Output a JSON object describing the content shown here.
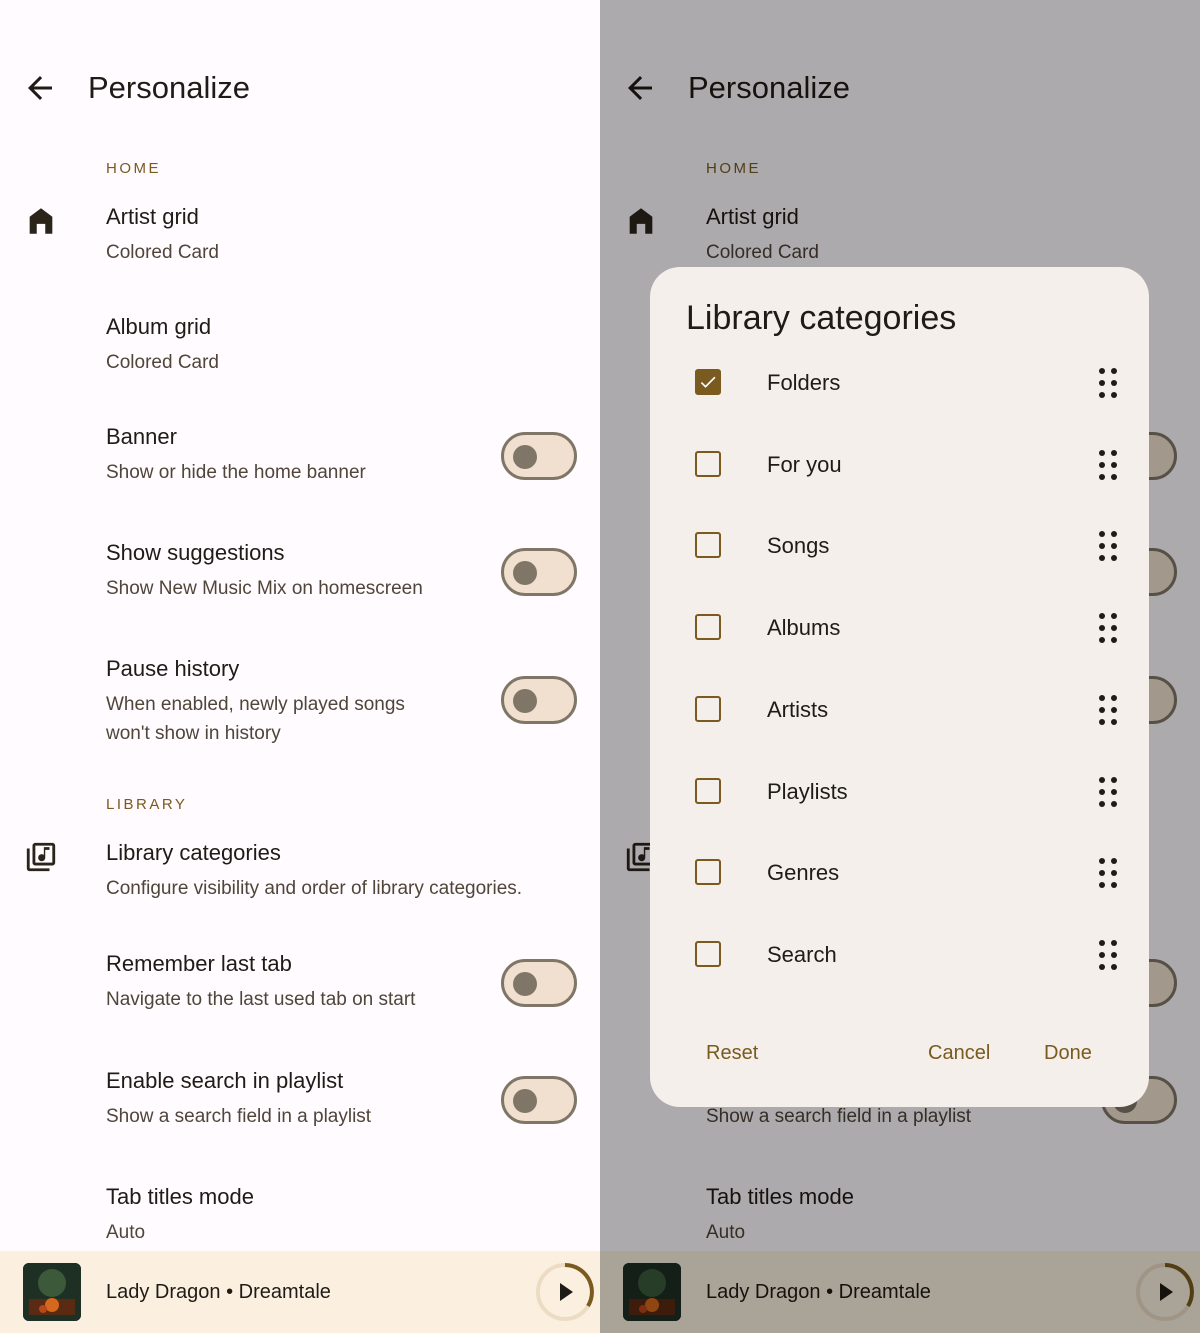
{
  "header": {
    "title": "Personalize"
  },
  "sections": {
    "home": "HOME",
    "library": "LIBRARY"
  },
  "items": {
    "artist_grid": {
      "title": "Artist grid",
      "subtitle": "Colored Card"
    },
    "album_grid": {
      "title": "Album grid",
      "subtitle": "Colored Card"
    },
    "banner": {
      "title": "Banner",
      "subtitle": "Show or hide the home banner"
    },
    "suggestions": {
      "title": "Show suggestions",
      "subtitle": "Show New Music Mix on homescreen"
    },
    "pause_history": {
      "title": "Pause history",
      "subtitle": "When enabled, newly played songs won't show in history"
    },
    "library_categories": {
      "title": "Library categories",
      "subtitle": "Configure visibility and order of library categories."
    },
    "remember_tab": {
      "title": "Remember last tab",
      "subtitle": "Navigate to the last used tab on start"
    },
    "search_playlist": {
      "title": "Enable search in playlist",
      "subtitle": "Show a search field in a playlist"
    },
    "tab_titles": {
      "title": "Tab titles mode",
      "subtitle": "Auto"
    }
  },
  "player": {
    "track": "Lady Dragon • Dreamtale"
  },
  "dialog": {
    "title": "Library categories",
    "categories": [
      {
        "label": "Folders",
        "checked": true
      },
      {
        "label": "For you",
        "checked": false
      },
      {
        "label": "Songs",
        "checked": false
      },
      {
        "label": "Albums",
        "checked": false
      },
      {
        "label": "Artists",
        "checked": false
      },
      {
        "label": "Playlists",
        "checked": false
      },
      {
        "label": "Genres",
        "checked": false
      },
      {
        "label": "Search",
        "checked": false
      }
    ],
    "reset_label": "Reset",
    "cancel_label": "Cancel",
    "done_label": "Done"
  },
  "colors": {
    "accent": "#7a5a1e",
    "background": "#fffbff",
    "player_bg": "#fbf0e0",
    "scrim": "rgba(0,0,0,0.32)"
  },
  "icons": {
    "back": "arrow-left-icon",
    "home": "home-icon",
    "library": "library-music-icon",
    "drag": "drag-handle-icon",
    "play": "play-icon"
  }
}
